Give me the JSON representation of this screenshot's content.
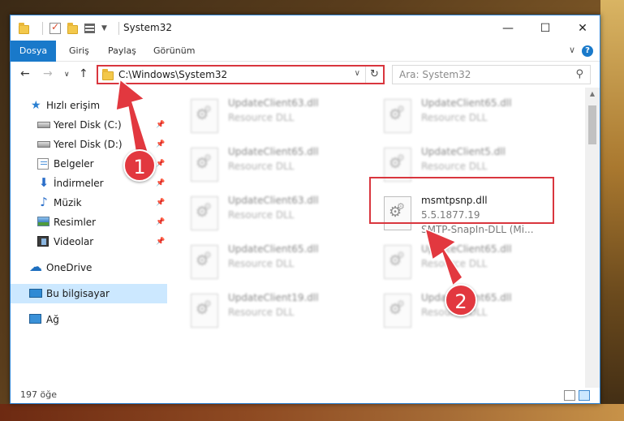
{
  "window": {
    "title": "System32",
    "accent": "#1979ca",
    "annotation_color": "#d9363e"
  },
  "ribbon": {
    "tabs": [
      "Dosya",
      "Giriş",
      "Paylaş",
      "Görünüm"
    ]
  },
  "address_bar": {
    "path": "C:\\Windows\\System32"
  },
  "search": {
    "placeholder": "Ara: System32"
  },
  "sidebar": {
    "quick_access": "Hızlı erişim",
    "items": [
      {
        "label": "Yerel Disk (C:)",
        "icon": "hard-disk-icon",
        "pinned": true
      },
      {
        "label": "Yerel Disk (D:)",
        "icon": "hard-disk-icon",
        "pinned": true
      },
      {
        "label": "Belgeler",
        "icon": "documents-icon",
        "pinned": true
      },
      {
        "label": "İndirmeler",
        "icon": "downloads-icon",
        "pinned": true
      },
      {
        "label": "Müzik",
        "icon": "music-icon",
        "pinned": true
      },
      {
        "label": "Resimler",
        "icon": "pictures-icon",
        "pinned": true
      },
      {
        "label": "Videolar",
        "icon": "videos-icon",
        "pinned": true
      }
    ],
    "onedrive": "OneDrive",
    "this_pc": "Bu bilgisayar",
    "network": "Ağ"
  },
  "files": [
    {
      "name": "UpdateClient63.dll",
      "meta": "Resource DLL"
    },
    {
      "name": "UpdateClient65.dll",
      "meta": "Resource DLL"
    },
    {
      "name": "UpdateClient65.dll",
      "meta": "Resource DLL"
    },
    {
      "name": "UpdateClient5.dll",
      "meta": "Resource DLL"
    },
    {
      "name": "UpdateClient63.dll",
      "meta": "Resource DLL"
    },
    {
      "name": "msmtpsnp.dll",
      "version": "5.5.1877.19",
      "description": "SMTP-SnapIn-DLL (Mi..."
    },
    {
      "name": "UpdateClient65.dll",
      "meta": "Resource DLL"
    },
    {
      "name": "UpdateClient65.dll",
      "meta": "Resource DLL"
    },
    {
      "name": "UpdateClient19.dll",
      "meta": "Resource DLL"
    },
    {
      "name": "UpdateClient65.dll",
      "meta": "Resource DLL"
    }
  ],
  "status": {
    "item_count": "197 öğe"
  },
  "annotations": {
    "step1": "1",
    "step2": "2"
  }
}
